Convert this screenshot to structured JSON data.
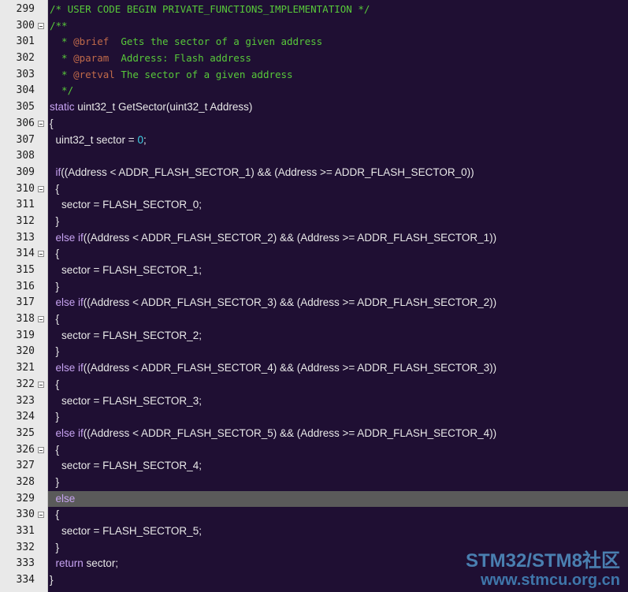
{
  "editor": {
    "current_line": 329,
    "colors": {
      "background": "#1f0f33",
      "gutter": "#e9e9e9",
      "comment": "#58c93a",
      "doc_tag": "#c06a4a",
      "keyword": "#c7a3f2",
      "number": "#3fd3e8",
      "text": "#e8e8e8",
      "current_line": "#5a5a5a"
    },
    "lines": [
      {
        "number": "299",
        "fold": false,
        "tokens": [
          {
            "t": "/* USER CODE BEGIN PRIVATE_FUNCTIONS_IMPLEMENTATION */",
            "c": "comment"
          }
        ]
      },
      {
        "number": "300",
        "fold": true,
        "tokens": [
          {
            "t": "/**",
            "c": "comment"
          }
        ]
      },
      {
        "number": "301",
        "fold": false,
        "tokens": [
          {
            "t": "  * ",
            "c": "comment"
          },
          {
            "t": "@brief",
            "c": "tag"
          },
          {
            "t": "  Gets the sector of a given address",
            "c": "comment"
          }
        ]
      },
      {
        "number": "302",
        "fold": false,
        "tokens": [
          {
            "t": "  * ",
            "c": "comment"
          },
          {
            "t": "@param",
            "c": "tag"
          },
          {
            "t": "  Address: Flash address",
            "c": "comment"
          }
        ]
      },
      {
        "number": "303",
        "fold": false,
        "tokens": [
          {
            "t": "  * ",
            "c": "comment"
          },
          {
            "t": "@retval",
            "c": "tag"
          },
          {
            "t": " The sector of a given address",
            "c": "comment"
          }
        ]
      },
      {
        "number": "304",
        "fold": false,
        "tokens": [
          {
            "t": "  */",
            "c": "comment"
          }
        ]
      },
      {
        "number": "305",
        "fold": false,
        "tokens": [
          {
            "t": "static",
            "c": "keyword"
          },
          {
            "t": " uint32_t GetSector(uint32_t Address)",
            "c": "plain"
          }
        ]
      },
      {
        "number": "306",
        "fold": true,
        "tokens": [
          {
            "t": "{",
            "c": "plain"
          }
        ]
      },
      {
        "number": "307",
        "fold": false,
        "tokens": [
          {
            "t": "  uint32_t sector = ",
            "c": "plain"
          },
          {
            "t": "0",
            "c": "number"
          },
          {
            "t": ";",
            "c": "plain"
          }
        ]
      },
      {
        "number": "308",
        "fold": false,
        "tokens": []
      },
      {
        "number": "309",
        "fold": false,
        "tokens": [
          {
            "t": "  ",
            "c": "plain"
          },
          {
            "t": "if",
            "c": "keyword"
          },
          {
            "t": "((Address < ADDR_FLASH_SECTOR_1) && (Address >= ADDR_FLASH_SECTOR_0))",
            "c": "plain"
          }
        ]
      },
      {
        "number": "310",
        "fold": true,
        "tokens": [
          {
            "t": "  {",
            "c": "plain"
          }
        ]
      },
      {
        "number": "311",
        "fold": false,
        "tokens": [
          {
            "t": "    sector = FLASH_SECTOR_0;",
            "c": "plain"
          }
        ]
      },
      {
        "number": "312",
        "fold": false,
        "tokens": [
          {
            "t": "  }",
            "c": "plain"
          }
        ]
      },
      {
        "number": "313",
        "fold": false,
        "tokens": [
          {
            "t": "  ",
            "c": "plain"
          },
          {
            "t": "else if",
            "c": "keyword"
          },
          {
            "t": "((Address < ADDR_FLASH_SECTOR_2) && (Address >= ADDR_FLASH_SECTOR_1))",
            "c": "plain"
          }
        ]
      },
      {
        "number": "314",
        "fold": true,
        "tokens": [
          {
            "t": "  {",
            "c": "plain"
          }
        ]
      },
      {
        "number": "315",
        "fold": false,
        "tokens": [
          {
            "t": "    sector = FLASH_SECTOR_1;",
            "c": "plain"
          }
        ]
      },
      {
        "number": "316",
        "fold": false,
        "tokens": [
          {
            "t": "  }",
            "c": "plain"
          }
        ]
      },
      {
        "number": "317",
        "fold": false,
        "tokens": [
          {
            "t": "  ",
            "c": "plain"
          },
          {
            "t": "else if",
            "c": "keyword"
          },
          {
            "t": "((Address < ADDR_FLASH_SECTOR_3) && (Address >= ADDR_FLASH_SECTOR_2))",
            "c": "plain"
          }
        ]
      },
      {
        "number": "318",
        "fold": true,
        "tokens": [
          {
            "t": "  {",
            "c": "plain"
          }
        ]
      },
      {
        "number": "319",
        "fold": false,
        "tokens": [
          {
            "t": "    sector = FLASH_SECTOR_2;",
            "c": "plain"
          }
        ]
      },
      {
        "number": "320",
        "fold": false,
        "tokens": [
          {
            "t": "  }",
            "c": "plain"
          }
        ]
      },
      {
        "number": "321",
        "fold": false,
        "tokens": [
          {
            "t": "  ",
            "c": "plain"
          },
          {
            "t": "else if",
            "c": "keyword"
          },
          {
            "t": "((Address < ADDR_FLASH_SECTOR_4) && (Address >= ADDR_FLASH_SECTOR_3))",
            "c": "plain"
          }
        ]
      },
      {
        "number": "322",
        "fold": true,
        "tokens": [
          {
            "t": "  {",
            "c": "plain"
          }
        ]
      },
      {
        "number": "323",
        "fold": false,
        "tokens": [
          {
            "t": "    sector = FLASH_SECTOR_3;",
            "c": "plain"
          }
        ]
      },
      {
        "number": "324",
        "fold": false,
        "tokens": [
          {
            "t": "  }",
            "c": "plain"
          }
        ]
      },
      {
        "number": "325",
        "fold": false,
        "tokens": [
          {
            "t": "  ",
            "c": "plain"
          },
          {
            "t": "else if",
            "c": "keyword"
          },
          {
            "t": "((Address < ADDR_FLASH_SECTOR_5) && (Address >= ADDR_FLASH_SECTOR_4))",
            "c": "plain"
          }
        ]
      },
      {
        "number": "326",
        "fold": true,
        "tokens": [
          {
            "t": "  {",
            "c": "plain"
          }
        ]
      },
      {
        "number": "327",
        "fold": false,
        "tokens": [
          {
            "t": "    sector = FLASH_SECTOR_4;",
            "c": "plain"
          }
        ]
      },
      {
        "number": "328",
        "fold": false,
        "tokens": [
          {
            "t": "  }",
            "c": "plain"
          }
        ]
      },
      {
        "number": "329",
        "fold": false,
        "tokens": [
          {
            "t": "  ",
            "c": "plain"
          },
          {
            "t": "else",
            "c": "keyword"
          }
        ]
      },
      {
        "number": "330",
        "fold": true,
        "tokens": [
          {
            "t": "  {",
            "c": "plain"
          }
        ]
      },
      {
        "number": "331",
        "fold": false,
        "tokens": [
          {
            "t": "    sector = FLASH_SECTOR_5;",
            "c": "plain"
          }
        ]
      },
      {
        "number": "332",
        "fold": false,
        "tokens": [
          {
            "t": "  }",
            "c": "plain"
          }
        ]
      },
      {
        "number": "333",
        "fold": false,
        "tokens": [
          {
            "t": "  ",
            "c": "plain"
          },
          {
            "t": "return",
            "c": "keyword"
          },
          {
            "t": " sector;",
            "c": "plain"
          }
        ]
      },
      {
        "number": "334",
        "fold": false,
        "tokens": [
          {
            "t": "}",
            "c": "plain"
          }
        ]
      }
    ]
  },
  "watermark": {
    "line1": "STM32/STM8社区",
    "line2": "www.stmcu.org.cn"
  }
}
